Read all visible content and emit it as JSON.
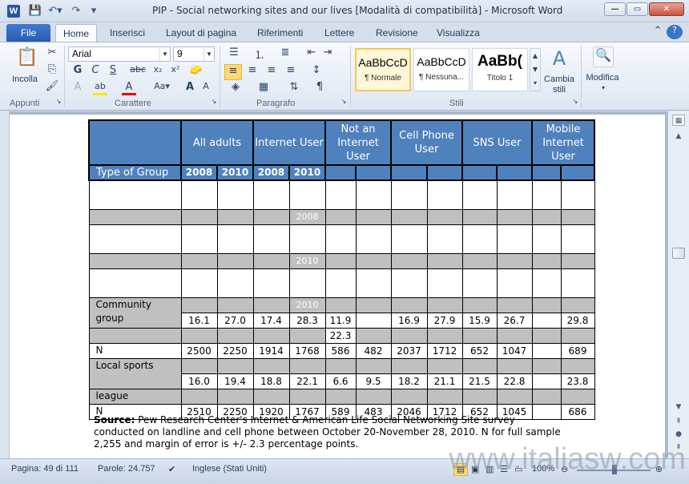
{
  "window": {
    "title": "PIP - Social networking sites and our lives [Modalità di compatibilità]  -  Microsoft Word",
    "app_icon": "W"
  },
  "quick_access": {
    "save_icon": "save-icon",
    "undo_icon": "undo-icon",
    "redo_icon": "redo-icon",
    "customize_icon": "customize-icon"
  },
  "tabs": [
    "File",
    "Home",
    "Inserisci",
    "Layout di pagina",
    "Riferimenti",
    "Lettere",
    "Revisione",
    "Visualizza"
  ],
  "ribbon": {
    "clipboard": {
      "paste_label": "Incolla",
      "group": "Appunti"
    },
    "font": {
      "name": "Arial",
      "size": "9",
      "group": "Carattere"
    },
    "paragraph": {
      "group": "Paragrafo"
    },
    "styles": {
      "group": "Stili",
      "items": [
        {
          "sample": "AaBbCcD",
          "name": "¶ Normale"
        },
        {
          "sample": "AaBbCcD",
          "name": "¶ Nessuna..."
        },
        {
          "sample": "AaBb(",
          "name": "Titolo 1"
        }
      ],
      "change_label": "Cambia stili"
    },
    "editing": {
      "label": "Modifica"
    }
  },
  "table": {
    "headers": [
      "All adults",
      "Internet User",
      "Not an Internet User",
      "Cell Phone User",
      "SNS User",
      "Mobile Internet User"
    ],
    "subheader": {
      "label": "Type of Group",
      "years": [
        "2008",
        "2010",
        "2008",
        "2010"
      ]
    },
    "rows": [
      {
        "label": "Community group",
        "values": [
          "16.1",
          "27.0",
          "17.4",
          "28.3",
          "11.9",
          "",
          "16.9",
          "27.9",
          "15.9",
          "26.7",
          "",
          "29.8"
        ],
        "extra": "22.3",
        "n": [
          "2500",
          "2250",
          "1914",
          "1768",
          "586",
          "482",
          "2037",
          "1712",
          "652",
          "1047",
          "",
          "689"
        ]
      },
      {
        "label": "Local sports",
        "values": [
          "16.0",
          "19.4",
          "18.8",
          "22.1",
          "6.6",
          "9.5",
          "18.2",
          "21.1",
          "21.5",
          "22.8",
          "",
          "23.8"
        ],
        "label2": "league",
        "n": [
          "2510",
          "2250",
          "1920",
          "1767",
          "589",
          "483",
          "2046",
          "1712",
          "652",
          "1045",
          "",
          "686"
        ]
      }
    ],
    "n_label": "N",
    "ghost": [
      "2008",
      "2010",
      "2010"
    ]
  },
  "source": {
    "bold": "Source:",
    "text": " Pew Research Center's Internet & American Life Social Networking Site survey conducted on landline and cell phone between October 20-November 28, 2010. N for full sample 2,255 and margin of error is +/- 2.3 percentage points."
  },
  "status": {
    "page": "Pagina: 49 di 111",
    "words": "Parole: 24.757",
    "language": "Inglese (Stati Uniti)",
    "zoom": "100%"
  },
  "watermark": "www.italiasw.com"
}
